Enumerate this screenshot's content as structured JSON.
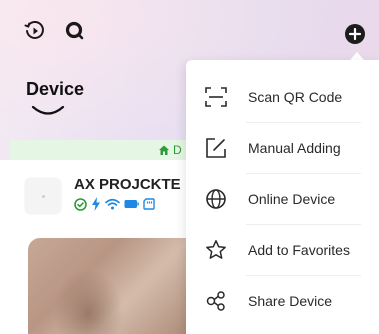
{
  "header": {
    "page_title": "Device"
  },
  "online_strip": {
    "text": "D"
  },
  "device": {
    "name": "AX PROJCKTE"
  },
  "menu": {
    "items": [
      {
        "label": "Scan QR Code",
        "icon": "scan-qr-icon"
      },
      {
        "label": "Manual Adding",
        "icon": "edit-icon"
      },
      {
        "label": "Online Device",
        "icon": "globe-icon"
      },
      {
        "label": "Add to Favorites",
        "icon": "star-icon"
      },
      {
        "label": "Share Device",
        "icon": "share-icon"
      }
    ]
  },
  "colors": {
    "online_green": "#2f9a3a",
    "status_blue": "#1e88e5",
    "status_orange": "#f6a21a"
  }
}
